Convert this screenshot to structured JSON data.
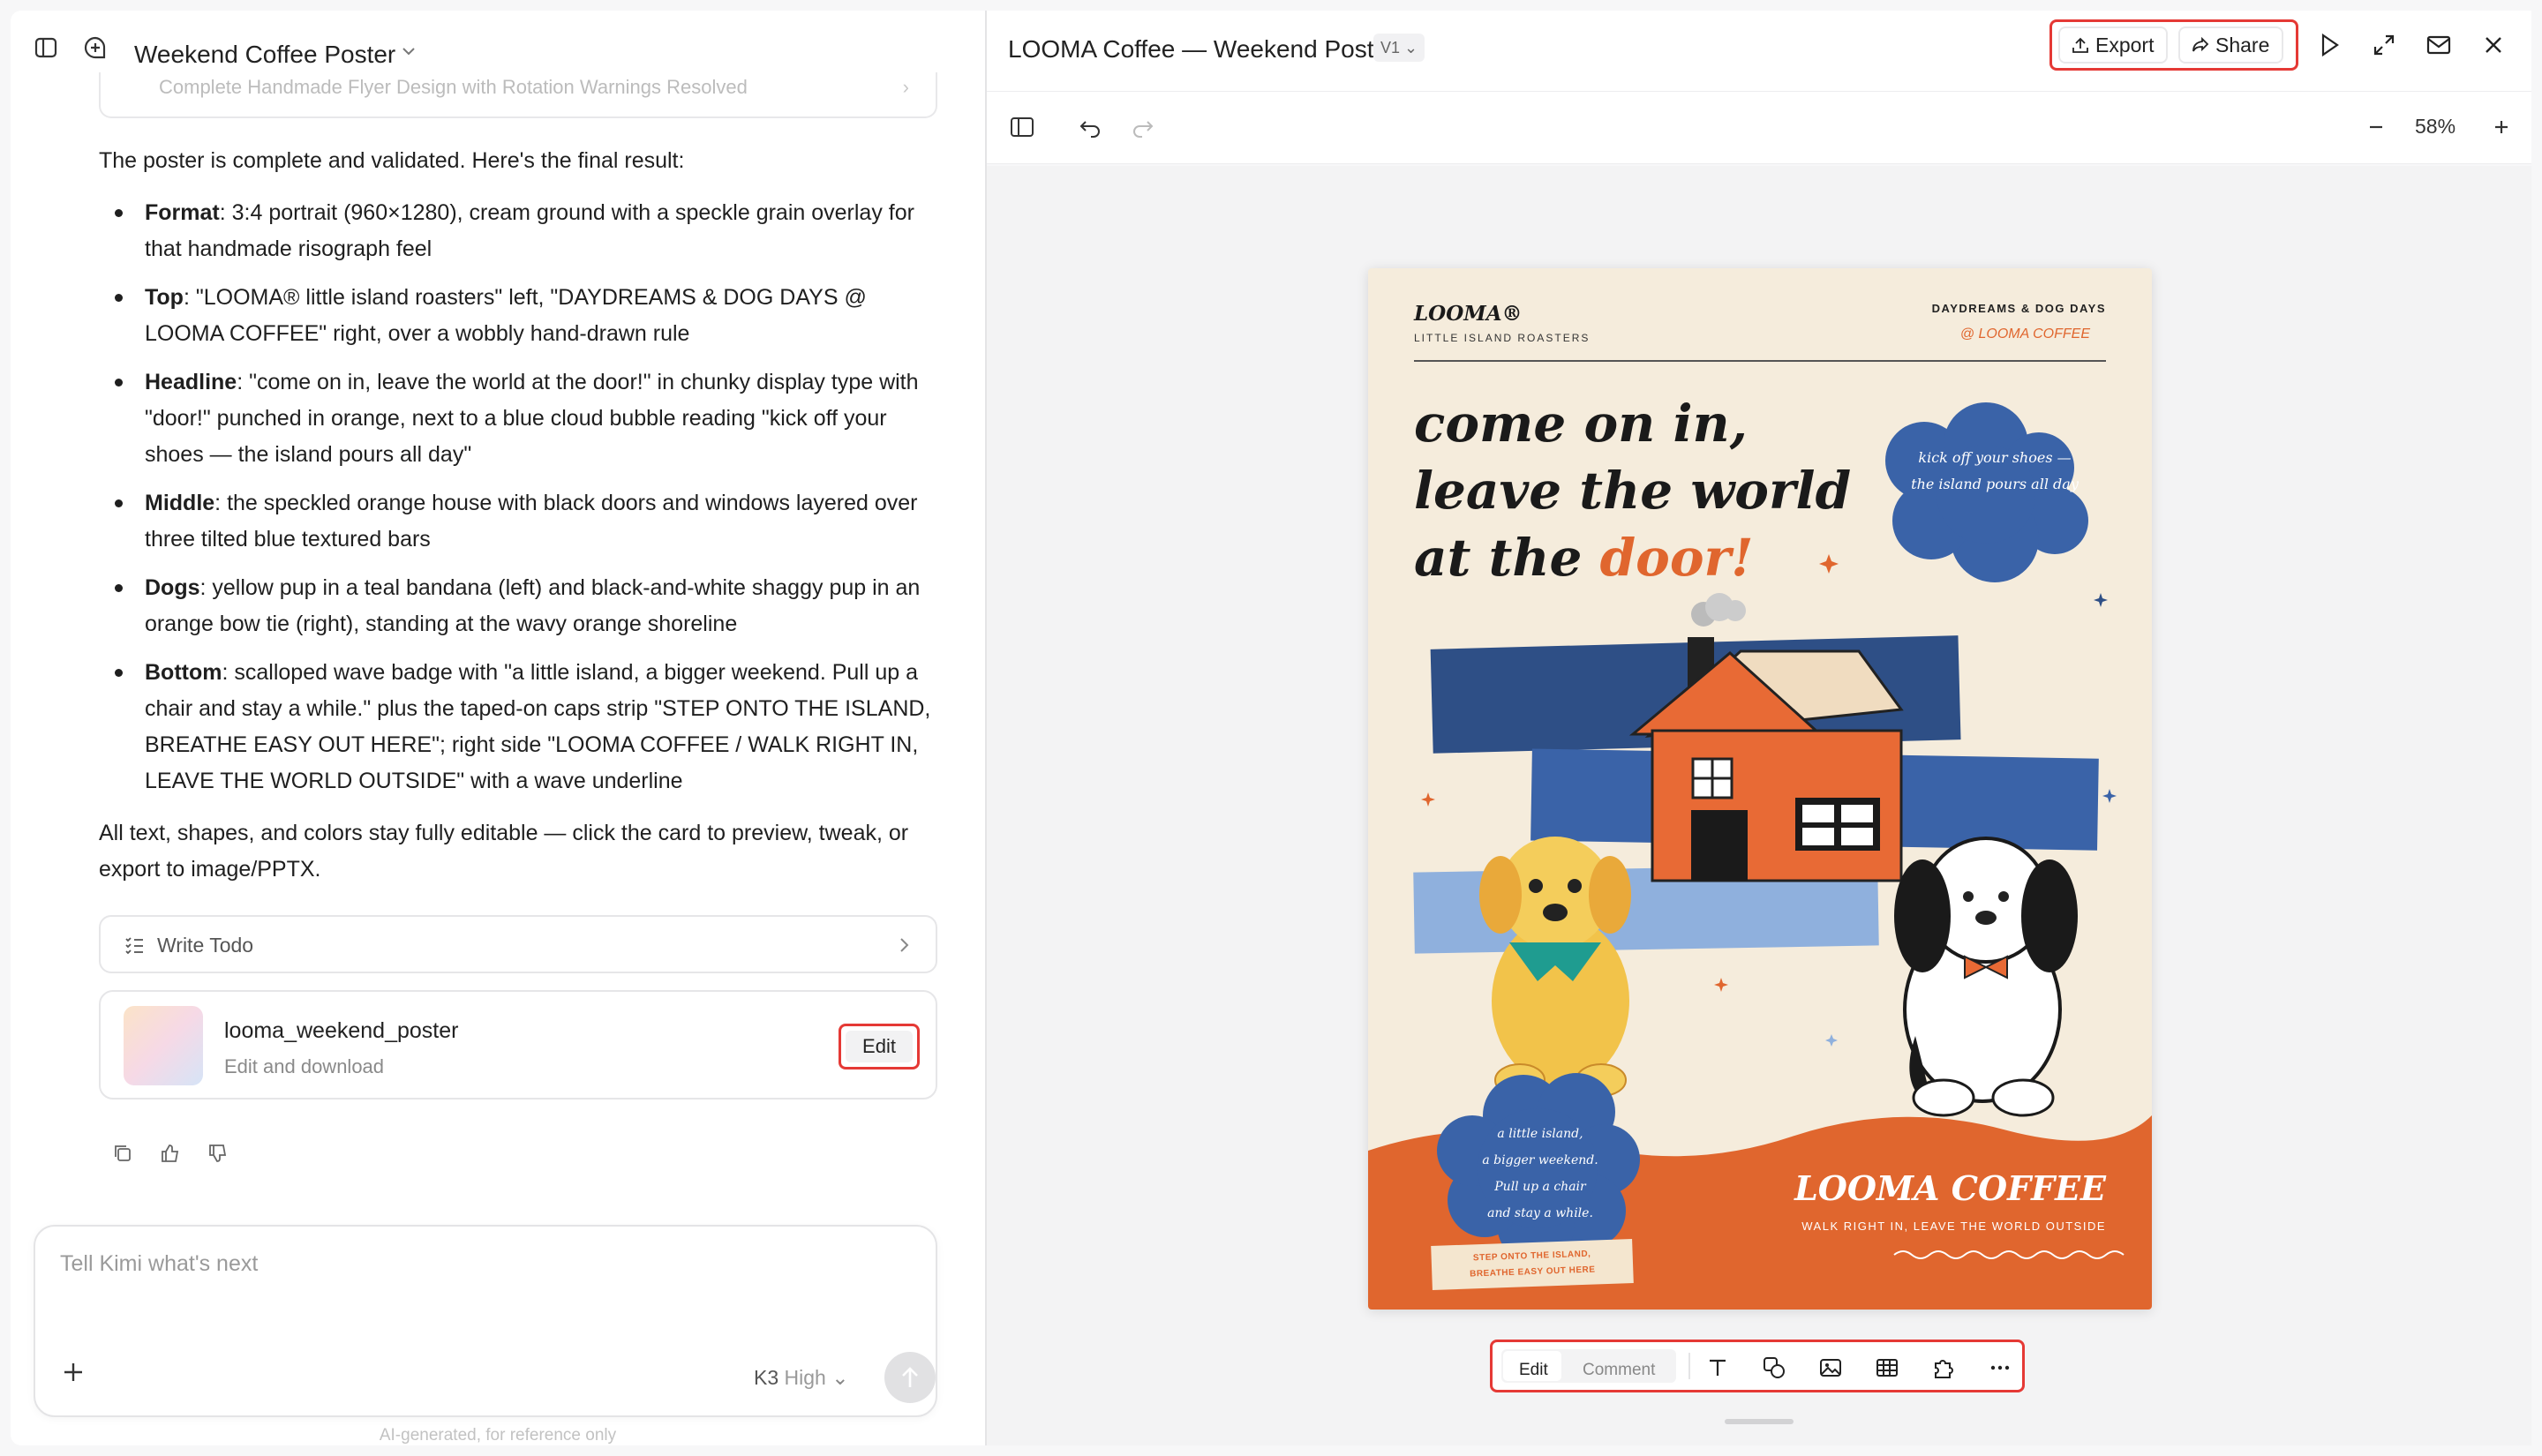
{
  "left": {
    "title": "Weekend Coffee Poster",
    "task_card": "Complete Handmade Flyer Design with Rotation Warnings Resolved",
    "message": {
      "intro": "The poster is complete and validated. Here's the final result:",
      "bullets": [
        {
          "label": "Format",
          "text": ": 3:4 portrait (960×1280), cream ground with a speckle grain overlay for that handmade risograph feel"
        },
        {
          "label": "Top",
          "text": ": \"LOOMA® little island roasters\" left, \"DAYDREAMS & DOG DAYS @ LOOMA COFFEE\" right, over a wobbly hand-drawn rule"
        },
        {
          "label": "Headline",
          "text": ": \"come on in, leave the world at the door!\" in chunky display type with \"door!\" punched in orange, next to a blue cloud bubble reading \"kick off your shoes — the island pours all day\""
        },
        {
          "label": "Middle",
          "text": ": the speckled orange house with black doors and windows layered over three tilted blue textured bars"
        },
        {
          "label": "Dogs",
          "text": ": yellow pup in a teal bandana (left) and black-and-white shaggy pup in an orange bow tie (right), standing at the wavy orange shoreline"
        },
        {
          "label": "Bottom",
          "text": ": scalloped wave badge with \"a little island, a bigger weekend. Pull up a chair and stay a while.\" plus the taped-on caps strip \"STEP ONTO THE ISLAND, BREATHE EASY OUT HERE\"; right side \"LOOMA COFFEE / WALK RIGHT IN, LEAVE THE WORLD OUTSIDE\" with a wave underline"
        }
      ],
      "outro": "All text, shapes, and colors stay fully editable — click the card to preview, tweak, or export to image/PPTX."
    },
    "todo_label": "Write Todo",
    "file": {
      "name": "looma_weekend_poster",
      "sub": "Edit and download",
      "edit_label": "Edit"
    },
    "composer": {
      "placeholder": "Tell Kimi what's next",
      "model": "K3",
      "mode": "High"
    },
    "footer": "AI-generated, for reference only"
  },
  "right": {
    "title": "LOOMA Coffee — Weekend Poster",
    "version": "V1",
    "export_label": "Export",
    "share_label": "Share",
    "zoom": "58%",
    "toolbar": {
      "edit": "Edit",
      "comment": "Comment"
    }
  },
  "poster": {
    "brand": "LOOMA®",
    "brand_sub": "LITTLE ISLAND ROASTERS",
    "top_right_1": "DAYDREAMS & DOG DAYS",
    "top_right_2": "@ LOOMA COFFEE",
    "headline_1": "come on in,",
    "headline_2": "leave the world",
    "headline_3a": "at the ",
    "headline_3b": "door!",
    "bubble_1": "kick off your shoes —",
    "bubble_2": "the island pours all day",
    "badge_1": "a little island,",
    "badge_2": "a bigger weekend.",
    "badge_3": "Pull up a chair",
    "badge_4": "and stay a while.",
    "strip_1": "STEP ONTO THE ISLAND,",
    "strip_2": "BREATHE EASY OUT HERE",
    "coffee": "LOOMA COFFEE",
    "tagline": "WALK RIGHT IN, LEAVE THE WORLD OUTSIDE"
  },
  "colors": {
    "accent_red": "#e53935",
    "poster_orange": "#e0662e",
    "poster_blue": "#3a63a8",
    "poster_cream": "#f5ecdc"
  }
}
